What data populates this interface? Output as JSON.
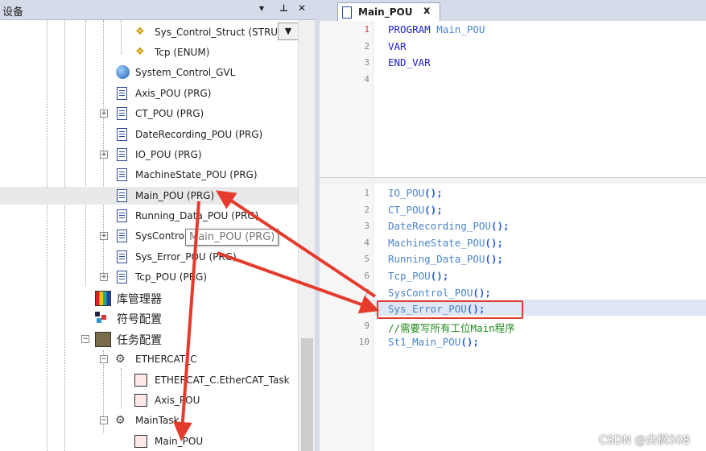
{
  "left_panel": {
    "title": "设备",
    "pin_label": "▾",
    "dock_label": "ᴉ",
    "close_label": "✕"
  },
  "tree": {
    "items": [
      {
        "label": "Sys_Control_Struct (STRUC",
        "icon": "struct-icon"
      },
      {
        "label": "Tcp (ENUM)",
        "icon": "enum-icon"
      },
      {
        "label": "System_Control_GVL",
        "icon": "globe-icon"
      },
      {
        "label": "Axis_POU (PRG)",
        "icon": "pou-icon"
      },
      {
        "label": "CT_POU (PRG)",
        "icon": "pou-icon"
      },
      {
        "label": "DateRecording_POU (PRG)",
        "icon": "pou-icon"
      },
      {
        "label": "IO_POU (PRG)",
        "icon": "pou-icon"
      },
      {
        "label": "MachineState_POU (PRG)",
        "icon": "pou-icon"
      },
      {
        "label": "Main_POU (PRG)",
        "icon": "pou-icon"
      },
      {
        "label": "Running_Data_POU (PRG)",
        "icon": "pou-icon"
      },
      {
        "label": "SysContro",
        "icon": "pou-icon"
      },
      {
        "label": "Sys_Error_POU (PRG)",
        "icon": "pou-icon"
      },
      {
        "label": "Tcp_POU (PRG)",
        "icon": "pou-icon"
      },
      {
        "label": "库管理器",
        "icon": "library-icon"
      },
      {
        "label": "符号配置",
        "icon": "symbol-icon"
      },
      {
        "label": "任务配置",
        "icon": "task-config-icon"
      },
      {
        "label": "ETHERCAT_C",
        "icon": "task-icon"
      },
      {
        "label": "ETHERCAT_C.EtherCAT_Task",
        "icon": "call-icon"
      },
      {
        "label": "Axis_POU",
        "icon": "call-icon"
      },
      {
        "label": "MainTask",
        "icon": "task-icon"
      },
      {
        "label": "Main_POU",
        "icon": "call-icon"
      }
    ],
    "tooltip": "Main_POU (PRG)",
    "dropdown_label": "▼"
  },
  "editor": {
    "tab_label": "Main_POU",
    "tab_close": "x",
    "decl_lines": [
      {
        "num": "1",
        "kw": "PROGRAM",
        "rest": " Main_POU"
      },
      {
        "num": "2",
        "kw": "VAR",
        "rest": ""
      },
      {
        "num": "3",
        "kw": "END_VAR",
        "rest": ""
      },
      {
        "num": "4",
        "kw": "",
        "rest": ""
      }
    ],
    "body_lines": [
      {
        "num": "1",
        "text": "IO_POU();"
      },
      {
        "num": "2",
        "text": "CT_POU();"
      },
      {
        "num": "3",
        "text": "DateRecording_POU();"
      },
      {
        "num": "4",
        "text": "MachineState_POU();"
      },
      {
        "num": "5",
        "text": "Running_Data_POU();"
      },
      {
        "num": "6",
        "text": "Tcp_POU();"
      },
      {
        "num": "7",
        "text": "SysControl_POU();"
      },
      {
        "num": "8",
        "text": "Sys_Error_POU();"
      },
      {
        "num": "9",
        "text": "//需要写所有工位Main程序"
      },
      {
        "num": "10",
        "text": "St1_Main_POU();"
      }
    ]
  },
  "annotations": {
    "arrow_color": "#e53b2c",
    "highlight_color": "#e53b2c"
  },
  "watermark": "CSDN @尖枫508"
}
